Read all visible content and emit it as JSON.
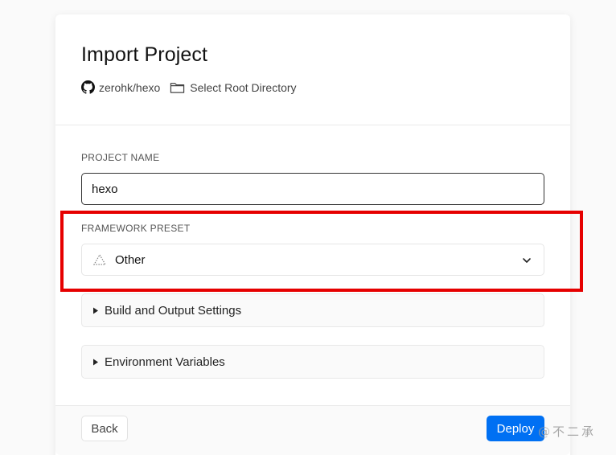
{
  "page": {
    "title": "Import Project",
    "repo": {
      "name": "zerohk/hexo",
      "icon": "github-icon"
    },
    "root_directory": {
      "label": "Select Root Directory",
      "icon": "folder-icon"
    }
  },
  "form": {
    "project_name_label": "PROJECT NAME",
    "project_name_value": "hexo",
    "framework_preset_label": "FRAMEWORK PRESET",
    "framework_preset_value": "Other",
    "framework_preset_icon": "dotted-triangle-icon",
    "sections": [
      {
        "label": "Build and Output Settings",
        "expanded": false
      },
      {
        "label": "Environment Variables",
        "expanded": false
      }
    ]
  },
  "footer": {
    "back_label": "Back",
    "deploy_label": "Deploy"
  },
  "watermark": "@不二承",
  "colors": {
    "accent": "#0070f3",
    "highlight": "#e60000"
  }
}
